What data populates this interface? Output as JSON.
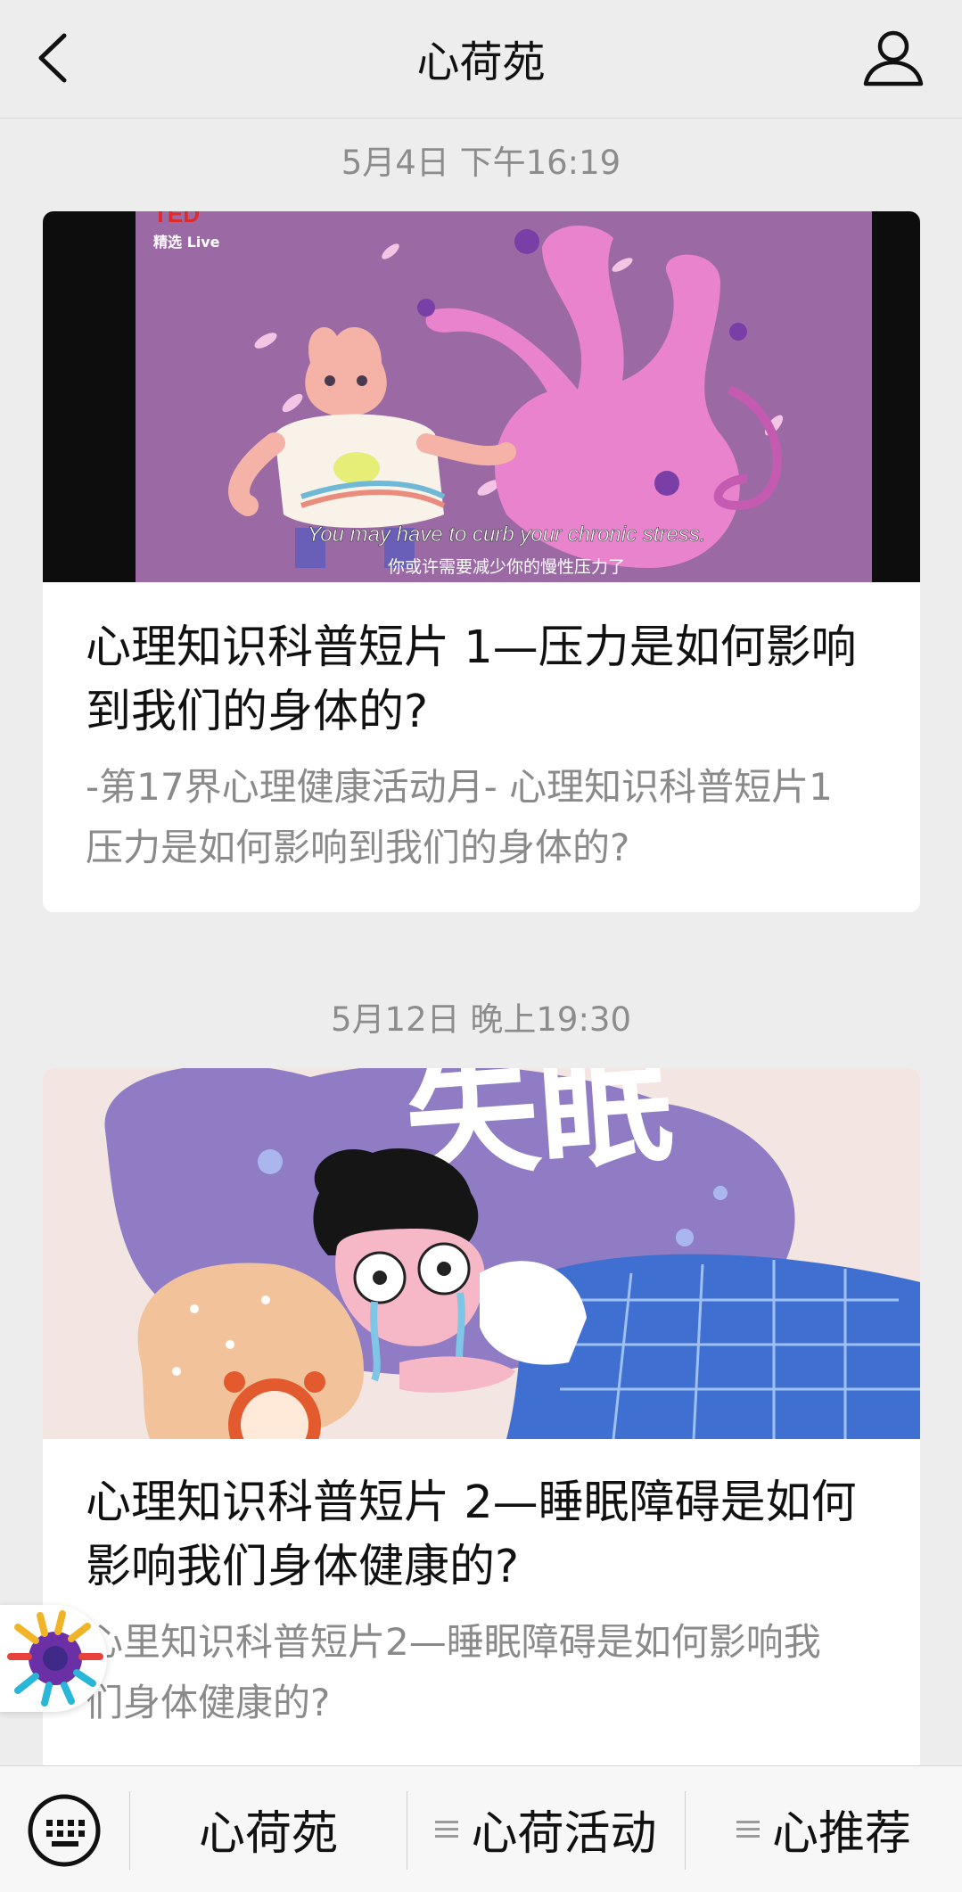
{
  "header": {
    "title": "心荷苑"
  },
  "feed": [
    {
      "timestamp": "5月4日 下午16:19",
      "cover": {
        "brand": "TED",
        "brand_sub": "精选 Live",
        "subtitle_en": "You may have to curb your chronic stress.",
        "subtitle_zh": "你或许需要减少你的慢性压力了"
      },
      "title": "心理知识科普短片 1—压力是如何影响到我们的身体的?",
      "description": "-第17界心理健康活动月- 心理知识科普短片1 压力是如何影响到我们的身体的?"
    },
    {
      "timestamp": "5月12日 晚上19:30",
      "cover": {
        "headline": "失眠"
      },
      "title": "心理知识科普短片 2—睡眠障碍是如何影响我们身体健康的?",
      "description": "心里知识科普短片2—睡眠障碍是如何影响我们身体健康的?"
    }
  ],
  "bottom_menu": {
    "items": [
      {
        "label": "心荷苑"
      },
      {
        "label": "心荷活动"
      },
      {
        "label": "心推荐"
      }
    ]
  }
}
